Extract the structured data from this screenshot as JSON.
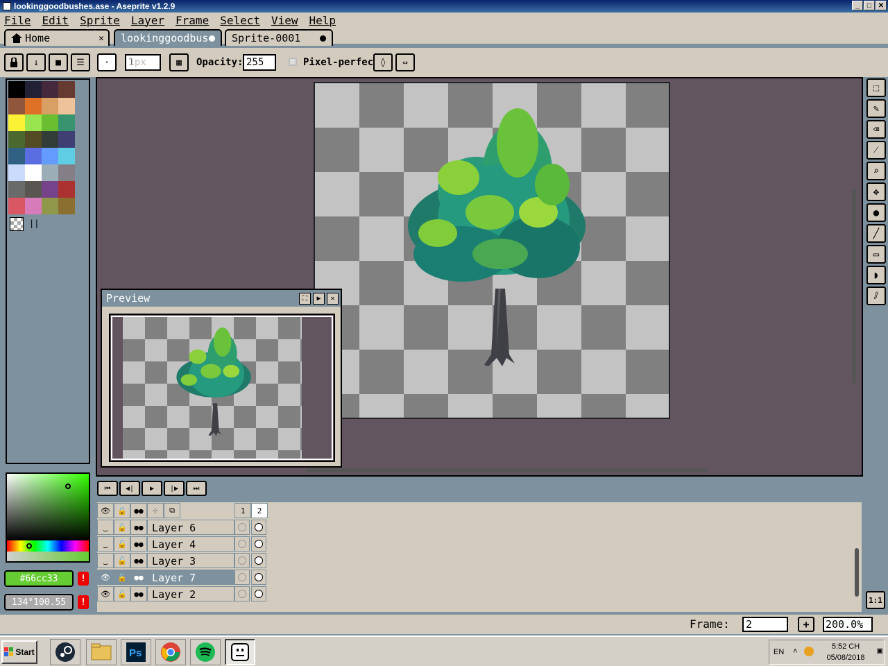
{
  "window": {
    "title": "lookinggoodbushes.ase - Aseprite v1.2.9",
    "min": "_",
    "max": "□",
    "close": "✕"
  },
  "menu": [
    "File",
    "Edit",
    "Sprite",
    "Layer",
    "Frame",
    "Select",
    "View",
    "Help"
  ],
  "tabs": [
    {
      "label": "Home",
      "icon": "home-icon"
    },
    {
      "label": "lookinggoodbus",
      "modified": true
    },
    {
      "label": "Sprite-0001",
      "modified": true
    }
  ],
  "toolbar": {
    "brush_size_placeholder": "1px",
    "brush_size_value": "1",
    "opacity_label": "Opacity:",
    "opacity_value": "255",
    "pixel_perfect_label": "Pixel-perfect",
    "pixel_perfect_checked": false
  },
  "palette": {
    "colors": [
      "#000000",
      "#222034",
      "#45283c",
      "#663931",
      "#8f563b",
      "#df7126",
      "#d9a066",
      "#eec39a",
      "#fbf236",
      "#99e550",
      "#6abe30",
      "#37946e",
      "#4b692f",
      "#524b24",
      "#323c39",
      "#3f3f74",
      "#306082",
      "#5b6ee1",
      "#639bff",
      "#5fcde4",
      "#cbdbfc",
      "#ffffff",
      "#9badb7",
      "#847e87",
      "#696a6a",
      "#595652",
      "#76428a",
      "#ac3232",
      "#d95763",
      "#d77bba",
      "#8f974a",
      "#8a6f30"
    ]
  },
  "colors": {
    "foreground": "#66cc33",
    "foreground_label": "#66cc33",
    "background_label": "134°100.55",
    "warn": "!"
  },
  "preview": {
    "title": "Preview"
  },
  "timeline": {
    "frames": [
      "1",
      "2"
    ],
    "layers": [
      {
        "name": "Layer 6",
        "visible": false,
        "active": false
      },
      {
        "name": "Layer 4",
        "visible": false,
        "active": false
      },
      {
        "name": "Layer 3",
        "visible": false,
        "active": false
      },
      {
        "name": "Layer 7",
        "visible": true,
        "active": true
      },
      {
        "name": "Layer 2",
        "visible": true,
        "active": false
      }
    ]
  },
  "status": {
    "frame_label": "Frame:",
    "frame_value": "2",
    "plus": "+",
    "zoom": "200.0%",
    "one_to_one": "1:1"
  },
  "taskbar": {
    "start": "Start",
    "lang": "EN",
    "time": "5:52 CH",
    "date": "05/08/2018"
  }
}
